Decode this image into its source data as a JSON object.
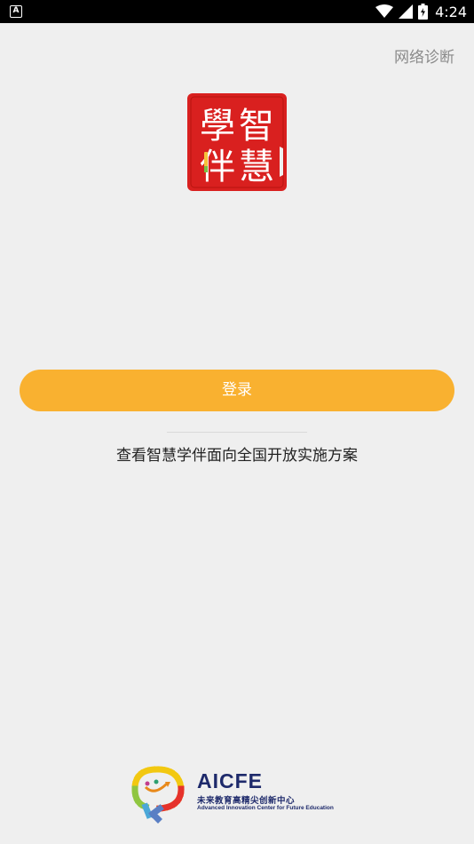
{
  "status_bar": {
    "left_icon_label": "A",
    "time": "4:24",
    "icons": [
      "wifi-icon",
      "cell-signal-icon",
      "battery-icon"
    ]
  },
  "header": {
    "network_link": "网络诊断"
  },
  "logo": {
    "icon": "xuezhixueban-seal-logo",
    "seal_text": [
      "學",
      "智",
      "伴",
      "慧"
    ],
    "color": "#d9201f"
  },
  "login": {
    "button_label": "登录",
    "button_color": "#f9b130"
  },
  "plan_link": {
    "label": "查看智慧学伴面向全国开放实施方案"
  },
  "footer": {
    "brand_title": "AICFE",
    "brand_cn": "未来教育高精尖创新中心",
    "brand_en": "Advanced Innovation Center for Future Education"
  }
}
